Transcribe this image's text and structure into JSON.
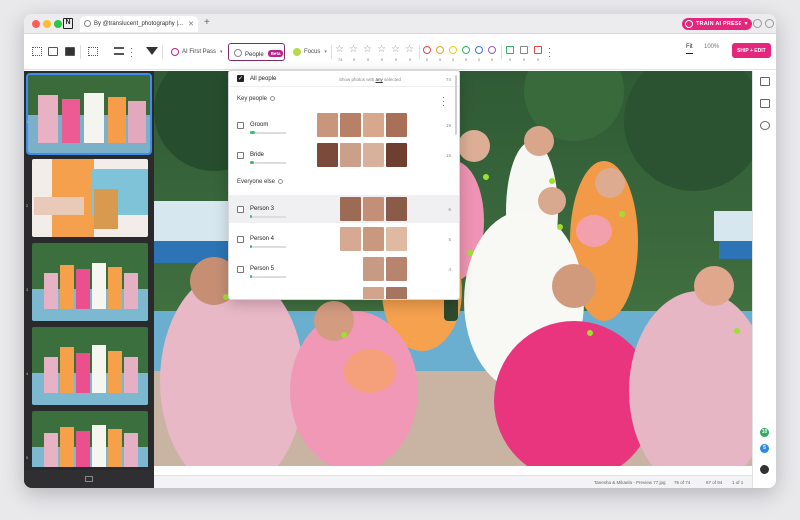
{
  "window": {
    "tab_title": "By @translucent_photography |...",
    "train_button": "TRAIN AI PRESET"
  },
  "toolbar": {
    "pill_ai": "AI First Pass",
    "pill_people": "People",
    "pill_people_badge": "Beta",
    "pill_focus": "Focus",
    "star_counts": [
      "74",
      "0",
      "0",
      "0",
      "0",
      "0"
    ],
    "color_counts": [
      "0",
      "0",
      "0",
      "0",
      "0",
      "0"
    ],
    "mark_counts": [
      "0",
      "0",
      "0"
    ],
    "fit_label": "Fit",
    "zoom_label": "100%",
    "ship_button": "SHIP + EDIT"
  },
  "filmstrip": {
    "thumb_numbers": [
      "1",
      "2",
      "3",
      "4",
      "5"
    ]
  },
  "people_panel": {
    "all_people": "All people",
    "show_photos_prefix": "Show photos with",
    "show_photos_mode": "any",
    "show_photos_suffix": "selected",
    "all_count": "74",
    "key_people_header": "Key people",
    "everyone_else_header": "Everyone else",
    "people": [
      {
        "name": "Groom",
        "count": "19"
      },
      {
        "name": "Bride",
        "count": "15"
      },
      {
        "name": "Person 3",
        "count": "6"
      },
      {
        "name": "Person 4",
        "count": "5"
      },
      {
        "name": "Person 5",
        "count": "4"
      }
    ]
  },
  "statusbar": {
    "filename": "Tanesha & Mikaela - Preview 77.jpg",
    "photo_index": "76 of 74",
    "filtered": "67 of 94",
    "selected": "1 of 1"
  },
  "rail": {
    "badge_green": "10",
    "badge_blue": "5"
  },
  "colors": {
    "accent": "#e4267d",
    "selection": "#3b8ef0",
    "focus_dot": "#9be22d",
    "people_outline": "#7a2b6f"
  }
}
